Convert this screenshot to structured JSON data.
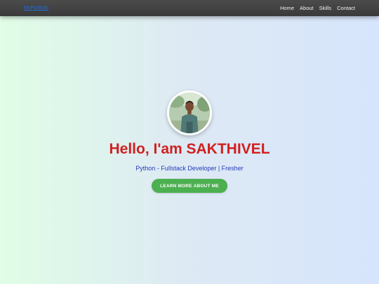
{
  "navbar": {
    "brand": "MyPortfolio",
    "links": [
      {
        "label": "Home"
      },
      {
        "label": "About"
      },
      {
        "label": "Skills"
      },
      {
        "label": "Contact"
      }
    ]
  },
  "hero": {
    "title": "Hello, I'am SAKTHIVEL",
    "subtitle": "Python - Fullstack Developer | Fresher",
    "cta_label": "LEARN MORE ABOUT ME"
  },
  "colors": {
    "title": "#d12020",
    "subtitle": "#2438b8",
    "cta_background": "#4caf50",
    "navbar_background": "#3f3f3f",
    "brand_link": "#1f6fe0"
  }
}
